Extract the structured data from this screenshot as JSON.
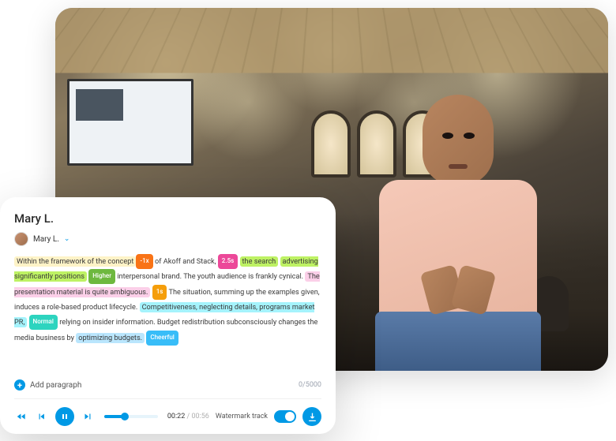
{
  "editor": {
    "title": "Mary L.",
    "speaker": {
      "name": "Mary L."
    },
    "segments": [
      {
        "text": "Within the framework of the concept",
        "style": "hl-yellow"
      },
      {
        "text": "-1x",
        "style": "tag tag-orange"
      },
      {
        "text": " of Akoff and Stack, "
      },
      {
        "text": "2.5s",
        "style": "tag tag-pink"
      },
      {
        "text": " "
      },
      {
        "text": "the search",
        "style": "hl-green"
      },
      {
        "text": " "
      },
      {
        "text": "advertising significantly positions",
        "style": "hl-green"
      },
      {
        "text": " "
      },
      {
        "text": "Higher",
        "style": "tag tag-green"
      },
      {
        "text": " interpersonal brand.  The youth audience is frankly cynical.  "
      },
      {
        "text": "The presentation material is quite ambiguous.",
        "style": "hl-pink"
      },
      {
        "text": " "
      },
      {
        "text": "1s",
        "style": "tag tag-orange2"
      },
      {
        "text": " The situation, summing up the examples given, induces a role-based product lifecycle. "
      },
      {
        "text": "Competitiveness, neglecting details, programs market PR,",
        "style": "hl-cyan"
      },
      {
        "text": " "
      },
      {
        "text": "Normal",
        "style": "tag tag-teal"
      },
      {
        "text": " relying on insider information. Budget redistribution subconsciously changes the media business by "
      },
      {
        "text": "optimizing budgets.",
        "style": "hl-sky"
      },
      {
        "text": " "
      },
      {
        "text": "Cheerful",
        "style": "tag tag-sky"
      }
    ],
    "add_paragraph_label": "Add paragraph",
    "char_count": "0/5000"
  },
  "player": {
    "current_time": "00:22",
    "total_time": "00:56",
    "watermark_label": "Watermark track",
    "watermark_on": true
  }
}
